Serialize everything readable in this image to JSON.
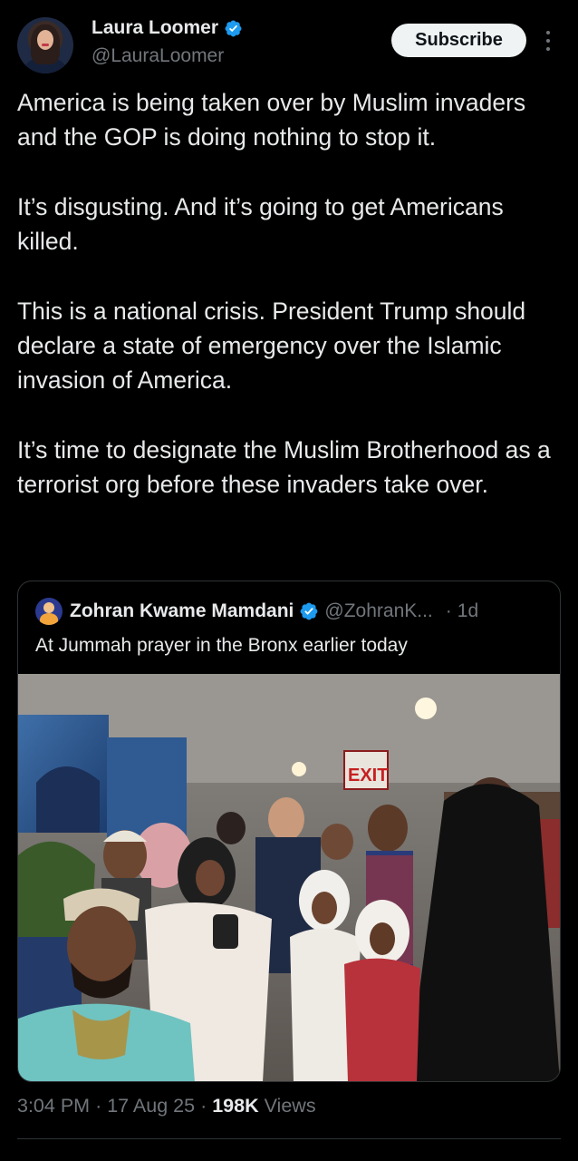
{
  "author": {
    "name": "Laura Loomer",
    "handle": "@LauraLoomer",
    "verified": true
  },
  "subscribe_label": "Subscribe",
  "more_icon": "more-vertical-icon",
  "tweet": {
    "paragraphs": [
      "America is being taken over by Muslim invaders and the GOP is doing nothing to stop it.",
      "It’s disgusting. And it’s going to get Americans killed.",
      "This is a national crisis. President Trump should declare a state of emergency over the Islamic invasion of America.",
      "It’s time to designate the Muslim Brotherhood as a terrorist org before these invaders take over."
    ]
  },
  "quoted": {
    "name": "Zohran Kwame Mamdani",
    "handle": "@ZohranK...",
    "separator": "·",
    "age": "1d",
    "text": "At Jummah prayer in the Bronx earlier today",
    "photo_signage": "EXIT"
  },
  "meta": {
    "time": "3:04 PM",
    "sep1": "·",
    "date": "17 Aug 25",
    "sep2": "·",
    "views_count": "198K",
    "views_label": "Views"
  },
  "colors": {
    "background": "#000000",
    "text_primary": "#e7e9ea",
    "text_secondary": "#71767b",
    "verified_blue": "#1d9bf0",
    "border": "#2f3336"
  }
}
